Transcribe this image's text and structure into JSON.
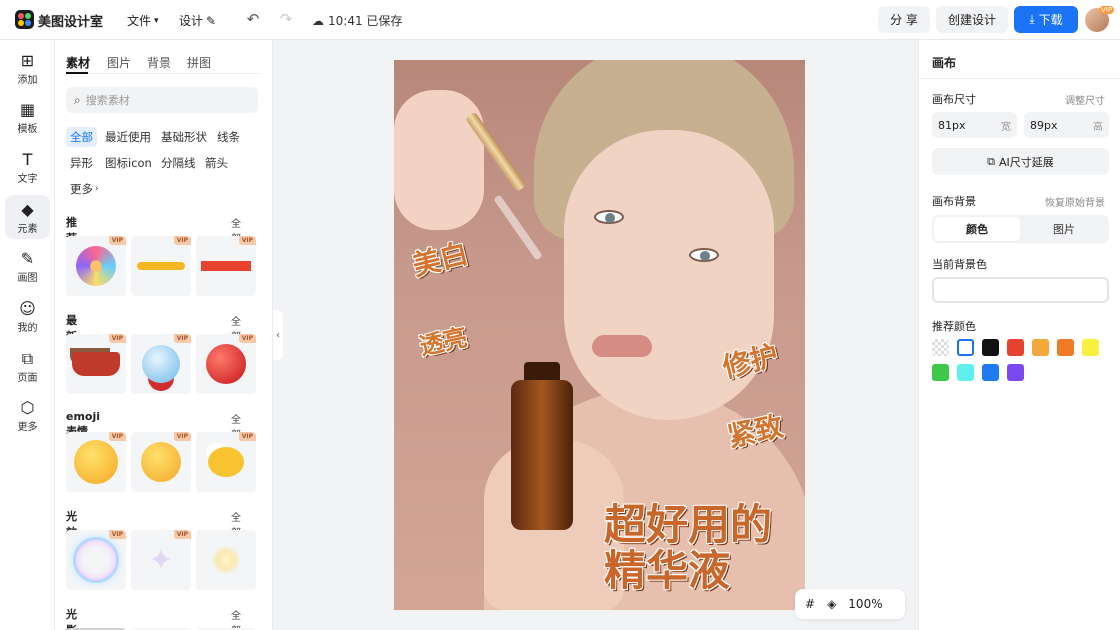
{
  "app": {
    "title": "美图设计室"
  },
  "menubar": {
    "file": "文件",
    "design": "设计",
    "save_status": "10:41 已保存"
  },
  "header_buttons": {
    "share": "分 享",
    "create": "创建设计",
    "download": "下载",
    "vip_badge": "VIP"
  },
  "left_rail": [
    {
      "label": "添加",
      "icon": "plus-square-icon",
      "glyph": "⊞"
    },
    {
      "label": "模板",
      "icon": "template-icon",
      "glyph": "▦"
    },
    {
      "label": "文字",
      "icon": "text-icon",
      "glyph": "T"
    },
    {
      "label": "元素",
      "icon": "shapes-icon",
      "glyph": "◆"
    },
    {
      "label": "画图",
      "icon": "pen-icon",
      "glyph": "✎"
    },
    {
      "label": "我的",
      "icon": "user-icon",
      "glyph": "☺"
    },
    {
      "label": "页面",
      "icon": "page-add-icon",
      "glyph": "⧉"
    },
    {
      "label": "更多",
      "icon": "cube-icon",
      "glyph": "⬡"
    }
  ],
  "panel": {
    "tabs": [
      "素材",
      "图片",
      "背景",
      "拼图"
    ],
    "search_placeholder": "搜索素材",
    "chips": [
      "全部",
      "最近使用",
      "基础形状",
      "线条",
      "异形",
      "图标icon",
      "分隔线",
      "箭头",
      "更多"
    ],
    "vip": "VIP",
    "all": "全部",
    "sections": [
      {
        "title": "推荐素材",
        "items": [
          "confetti-popper",
          "yellow-brush-stroke",
          "red-bar"
        ]
      },
      {
        "title": "最新素材",
        "items": [
          "reindeer-sleigh",
          "snow-globe-gifts",
          "red-apple"
        ]
      },
      {
        "title": "emoji表情",
        "items": [
          "shocked-face",
          "thinking-face",
          "chick-calendar"
        ]
      },
      {
        "title": "光效",
        "items": [
          "bubble-ring",
          "star-sparkle",
          "soft-glow"
        ]
      },
      {
        "title": "光影",
        "items": []
      }
    ]
  },
  "canvas": {
    "words": [
      "美白",
      "透亮",
      "修护",
      "紧致"
    ],
    "headline_line1": "超好用的",
    "headline_line2": "精华液"
  },
  "canvas_toolbar": {
    "zoom": "100%"
  },
  "right_panel": {
    "title": "画布",
    "size_label": "画布尺寸",
    "adjust_size": "调整尺寸",
    "width_value": "81px",
    "width_unit": "宽",
    "height_value": "89px",
    "height_unit": "高",
    "ai_extend": "AI尺寸延展",
    "bg_label": "画布背景",
    "restore_bg": "恢复原始背景",
    "seg_color": "颜色",
    "seg_image": "图片",
    "current_bg_label": "当前背景色",
    "recommend_label": "推荐颜色",
    "swatches": [
      "transparent",
      "#ffffff",
      "#111111",
      "#e8432e",
      "#f5a93c",
      "#f07a25",
      "#f7f03e",
      "#3ec94a",
      "#5ef0ee",
      "#1f7bf0",
      "#7a49ef"
    ]
  }
}
